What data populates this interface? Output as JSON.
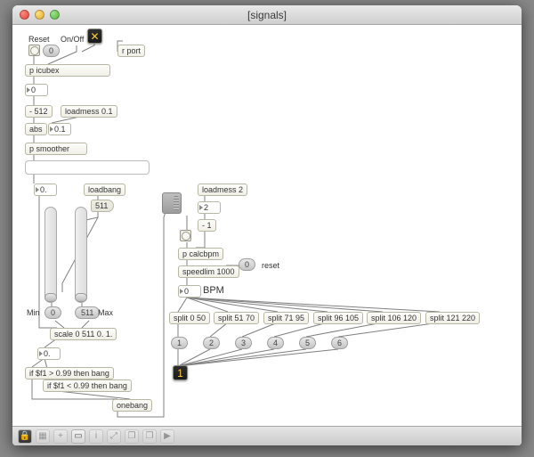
{
  "window": {
    "title": "[signals]"
  },
  "top": {
    "reset_label": "Reset",
    "onoff_label": "On/Off",
    "zero1": "0",
    "rport": "r port",
    "p_icubex": "p icubex",
    "n_zero_a": "0",
    "minus512": "- 512",
    "loadmess01": "loadmess 0.1",
    "abs": "abs",
    "n_01": "0.1",
    "p_smoother": "p smoother",
    "n_zero_b": "0.",
    "loadbang": "loadbang",
    "msg511": "511",
    "min_label": "Min",
    "max_label": "Max",
    "min_val": "0",
    "max_val": "511",
    "scale": "scale 0 511 0. 1.",
    "n_zero_c": "0.",
    "if_gt": "if $f1 > 0.99 then bang",
    "if_lt": "if $f1 < 0.99 then bang",
    "onebang": "onebang"
  },
  "right": {
    "loadmess2": "loadmess 2",
    "n2": "2",
    "neg1": "- 1",
    "p_calcbpm": "p calcbpm",
    "speedlim": "speedlim 1000",
    "reset_pill": "0",
    "reset_label": "reset",
    "n_zero": "0",
    "bpm_label": "BPM",
    "splits": [
      "split 0 50",
      "split 51 70",
      "split 71 95",
      "split 96 105",
      "split 106 120",
      "split 121 220"
    ],
    "pills": [
      "1",
      "2",
      "3",
      "4",
      "5",
      "6"
    ],
    "out_val": "1"
  },
  "bottombar": {
    "icons": [
      "lock",
      "plus",
      "plus",
      "presentation",
      "info",
      "zoom",
      "doc",
      "doc2",
      "play"
    ]
  }
}
